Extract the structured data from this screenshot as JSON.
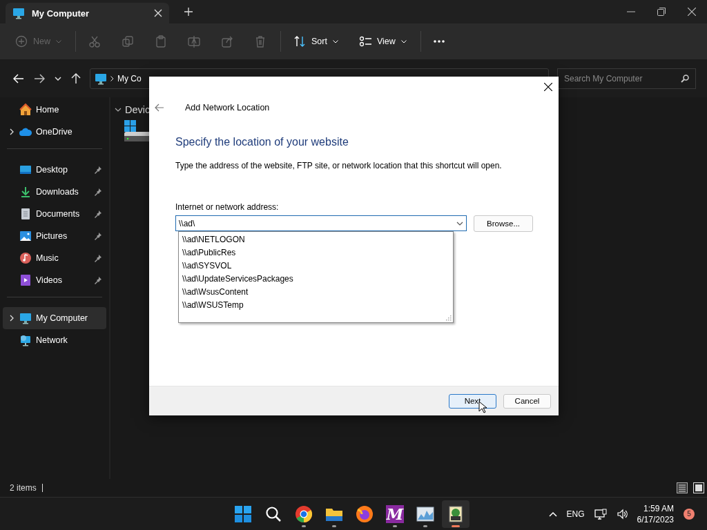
{
  "window": {
    "tab": {
      "title": "My Computer",
      "selected": true
    }
  },
  "toolbar": {
    "items": [
      {
        "kind": "new",
        "label": "New",
        "disabled": true
      },
      {
        "kind": "cut",
        "disabled": true
      },
      {
        "kind": "copy",
        "disabled": true
      },
      {
        "kind": "paste",
        "disabled": true
      },
      {
        "kind": "rename",
        "disabled": true
      },
      {
        "kind": "share",
        "disabled": true
      },
      {
        "kind": "delete",
        "disabled": true
      },
      {
        "kind": "sort",
        "label": "Sort",
        "disabled": false
      },
      {
        "kind": "view",
        "label": "View",
        "disabled": false
      },
      {
        "kind": "more",
        "disabled": false
      }
    ]
  },
  "address": {
    "crumb": "My Co"
  },
  "search": {
    "placeholder": "Search My Computer"
  },
  "sidebar": {
    "sections": [
      {
        "items": [
          {
            "label": "Home",
            "kind": "home",
            "expandable": false,
            "pinned": false,
            "selected": false
          },
          {
            "label": "OneDrive",
            "kind": "cloud",
            "expandable": true,
            "pinned": false,
            "selected": false
          }
        ]
      },
      {
        "items": [
          {
            "label": "Desktop",
            "kind": "desktop",
            "expandable": false,
            "pinned": true,
            "selected": false
          },
          {
            "label": "Downloads",
            "kind": "download",
            "expandable": false,
            "pinned": true,
            "selected": false
          },
          {
            "label": "Documents",
            "kind": "document",
            "expandable": false,
            "pinned": true,
            "selected": false
          },
          {
            "label": "Pictures",
            "kind": "picture",
            "expandable": false,
            "pinned": true,
            "selected": false
          },
          {
            "label": "Music",
            "kind": "music",
            "expandable": false,
            "pinned": true,
            "selected": false
          },
          {
            "label": "Videos",
            "kind": "video",
            "expandable": false,
            "pinned": true,
            "selected": false
          }
        ]
      },
      {
        "items": [
          {
            "label": "My Computer",
            "kind": "computer",
            "expandable": true,
            "pinned": false,
            "selected": true
          },
          {
            "label": "Network",
            "kind": "network",
            "expandable": false,
            "pinned": false,
            "selected": false
          }
        ]
      }
    ]
  },
  "content": {
    "group_header": "Devic"
  },
  "status_bar": {
    "count": "2 items"
  },
  "dialog": {
    "title": "Add Network Location",
    "heading": "Specify the location of your website",
    "description": "Type the address of the website, FTP site, or network location that this shortcut will open.",
    "field_label": "Internet or network address:",
    "field_value": "\\\\ad\\",
    "suggestions": [
      "\\\\ad\\NETLOGON",
      "\\\\ad\\PublicRes",
      "\\\\ad\\SYSVOL",
      "\\\\ad\\UpdateServicesPackages",
      "\\\\ad\\WsusContent",
      "\\\\ad\\WSUSTemp"
    ],
    "browse": "Browse...",
    "buttons": [
      {
        "label": "Next",
        "default": true
      },
      {
        "label": "Cancel",
        "default": false
      }
    ]
  },
  "taskbar": {
    "apps": [
      {
        "kind": "start",
        "running": false,
        "active": false
      },
      {
        "kind": "search",
        "running": false,
        "active": false
      },
      {
        "kind": "chrome",
        "running": true,
        "active": false
      },
      {
        "kind": "folder",
        "running": true,
        "active": false
      },
      {
        "kind": "firefox",
        "running": false,
        "active": false
      },
      {
        "kind": "letter",
        "glyph": "M",
        "running": true,
        "active": false
      },
      {
        "kind": "monitor",
        "running": true,
        "active": false
      },
      {
        "kind": "setup",
        "running": true,
        "active": true
      }
    ],
    "tray": {
      "language": "ENG",
      "time": "1:59 AM",
      "date": "6/17/2023",
      "badge": "5"
    }
  }
}
